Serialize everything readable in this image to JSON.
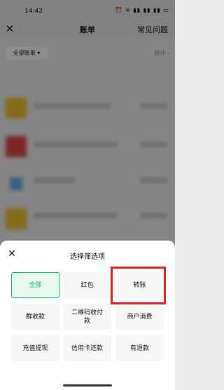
{
  "status": {
    "time": "14:42",
    "icons_text": "⏰ ≋ ▮▮ ▮▮ ▮▮ ▭"
  },
  "header": {
    "title": "账单",
    "faq": "常见问题"
  },
  "toolbar": {
    "filter_chip": "全部账单 ▾",
    "stats": "统计 ›"
  },
  "sheet": {
    "title": "选择筛选项",
    "options": [
      "全部",
      "红包",
      "转账",
      "群收款",
      "二维码收付款",
      "商户消费",
      "充值提现",
      "信用卡还款",
      "有退款"
    ],
    "selected_index": 0,
    "highlighted_index": 2
  },
  "colors": {
    "accent": "#07c160",
    "highlight": "#e02020"
  }
}
